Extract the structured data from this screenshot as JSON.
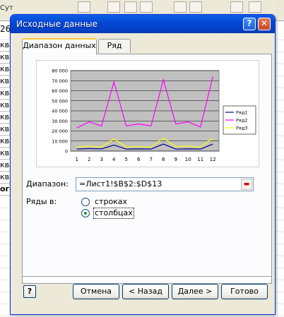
{
  "sheet": {
    "frag": "Сут",
    "num": "26",
    "col": [
      "ква",
      "ква",
      "ква",
      "ква",
      "ква",
      "ква",
      "ква",
      "ква",
      "ква",
      "ква",
      "ква",
      "ква",
      "ого"
    ]
  },
  "dialog": {
    "title": "Исходные данные",
    "help_glyph": "?",
    "close_glyph": "✕",
    "tabs": [
      "Диапазон данных",
      "Ряд"
    ],
    "range_label": "Диапазон:",
    "range_value": "=Лист1!$B$2:$D$13",
    "series_label": "Ряды в:",
    "radio_rows": "строках",
    "radio_cols": "столбцах",
    "radio_selected": "столбцах",
    "buttons": {
      "help": "?",
      "cancel": "Отмена",
      "back": "< Назад",
      "next": "Далее >",
      "finish": "Готово"
    }
  },
  "colors": {
    "series1": "#000080",
    "series2": "#ff00ff",
    "series3": "#ffff00",
    "plot_bg": "#c0c0c0"
  },
  "chart_data": {
    "type": "line",
    "x": [
      1,
      2,
      3,
      4,
      5,
      6,
      7,
      8,
      9,
      10,
      11,
      12
    ],
    "ylim": [
      0,
      80000
    ],
    "yticks": [
      0,
      10000,
      20000,
      30000,
      40000,
      50000,
      60000,
      70000,
      80000
    ],
    "ytick_labels": [
      "0",
      "10 000",
      "20 000",
      "30 000",
      "40 000",
      "50 000",
      "60 000",
      "70 000",
      "80 000"
    ],
    "grid": true,
    "legend": "right",
    "series": [
      {
        "name": "Ряд1",
        "values": [
          2000,
          2500,
          2200,
          6000,
          2000,
          2200,
          2000,
          7000,
          2000,
          2200,
          2000,
          7000
        ]
      },
      {
        "name": "Ряд2",
        "values": [
          23000,
          29000,
          25000,
          69000,
          25000,
          27000,
          25000,
          71000,
          27000,
          29000,
          24000,
          74000
        ]
      },
      {
        "name": "Ряд3",
        "values": [
          4000,
          5000,
          4000,
          12000,
          4000,
          4500,
          4000,
          13000,
          4500,
          5000,
          4000,
          13000
        ]
      }
    ]
  }
}
